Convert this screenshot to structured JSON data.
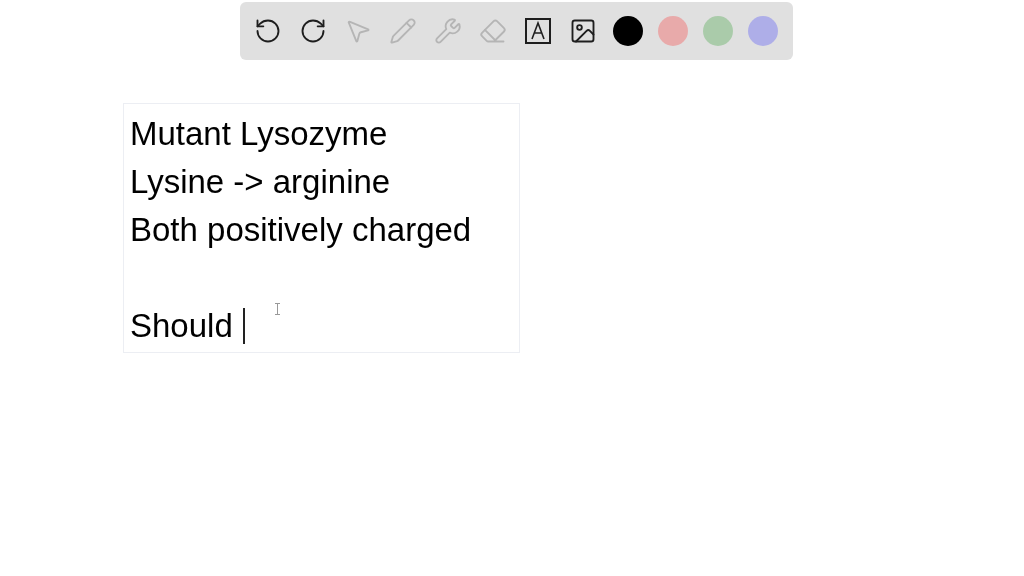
{
  "toolbar": {
    "tools": [
      {
        "kind": "undo",
        "disabled": false
      },
      {
        "kind": "redo",
        "disabled": false
      },
      {
        "kind": "pointer",
        "disabled": true
      },
      {
        "kind": "pen",
        "disabled": true
      },
      {
        "kind": "tools",
        "disabled": true
      },
      {
        "kind": "eraser",
        "disabled": true
      },
      {
        "kind": "text",
        "disabled": false
      },
      {
        "kind": "image",
        "disabled": false
      }
    ],
    "colors": [
      {
        "color": "#000000"
      },
      {
        "color": "#e8aaaa"
      },
      {
        "color": "#aacbaa"
      },
      {
        "color": "#aeaee8"
      }
    ]
  },
  "text_box": {
    "paragraphs": [
      [
        "Mutant Lysozyme",
        "Lysine -> arginine",
        "Both positively charged"
      ],
      [
        "Should"
      ]
    ],
    "caret": true
  }
}
